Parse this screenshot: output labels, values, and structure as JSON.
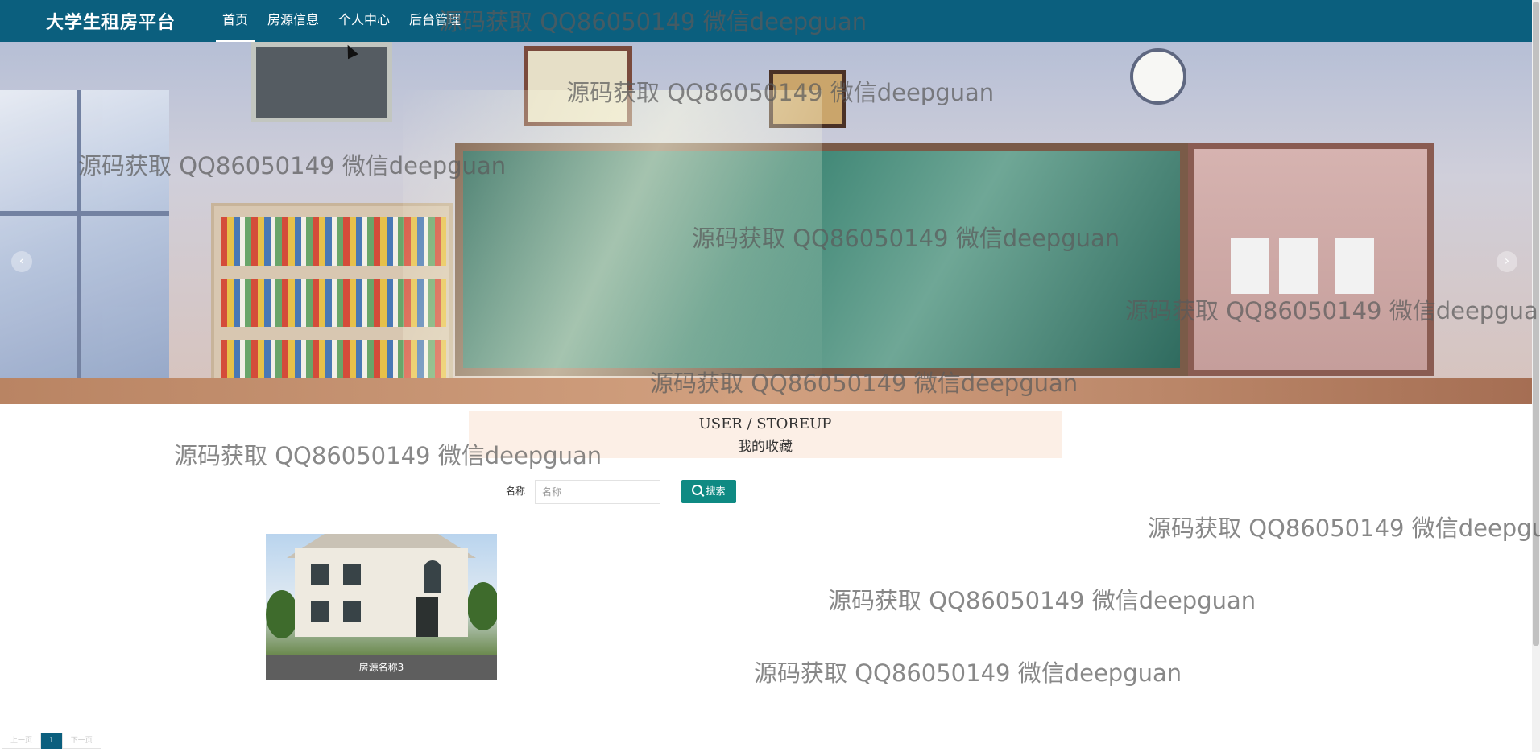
{
  "header": {
    "brand": "大学生租房平台",
    "nav": [
      "首页",
      "房源信息",
      "个人中心",
      "后台管理"
    ]
  },
  "banner": {
    "prev_arrow": "‹",
    "next_arrow": "›"
  },
  "section": {
    "title_en": "USER / STOREUP",
    "title_cn": "我的收藏"
  },
  "search": {
    "label": "名称",
    "placeholder": "名称",
    "button_label": "搜索"
  },
  "favorites": [
    {
      "name": "房源名称3"
    }
  ],
  "pagination": {
    "prev": "上一页",
    "current": "1",
    "next": "下一页"
  },
  "watermark": "源码获取 QQ86050149 微信deepguan"
}
